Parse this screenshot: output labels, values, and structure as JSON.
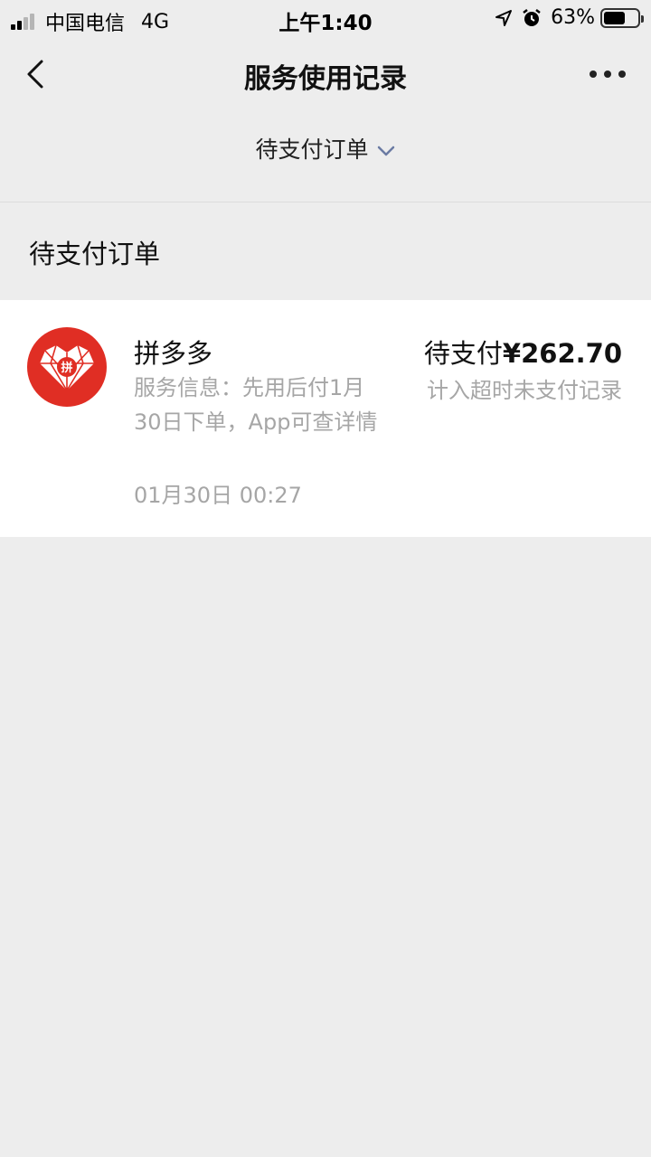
{
  "status_bar": {
    "carrier": "中国电信",
    "network": "4G",
    "time": "上午1:40",
    "battery": "63%",
    "battery_level": 0.63
  },
  "nav": {
    "title": "服务使用记录"
  },
  "filter": {
    "label": "待支付订单"
  },
  "section": {
    "title": "待支付订单"
  },
  "order": {
    "app_name": "拼多多",
    "info": "服务信息：先用后付1月30日下单，App可查详情",
    "date": "01月30日 00:27",
    "status_label": "待支付",
    "amount": "¥262.70",
    "note": "计入超时未支付记录",
    "logo_text": "拼"
  },
  "colors": {
    "background": "#ededed",
    "card": "#ffffff",
    "brand_red": "#e02e24",
    "secondary_text": "#a6a6a6",
    "chevron": "#6b7ba3"
  }
}
